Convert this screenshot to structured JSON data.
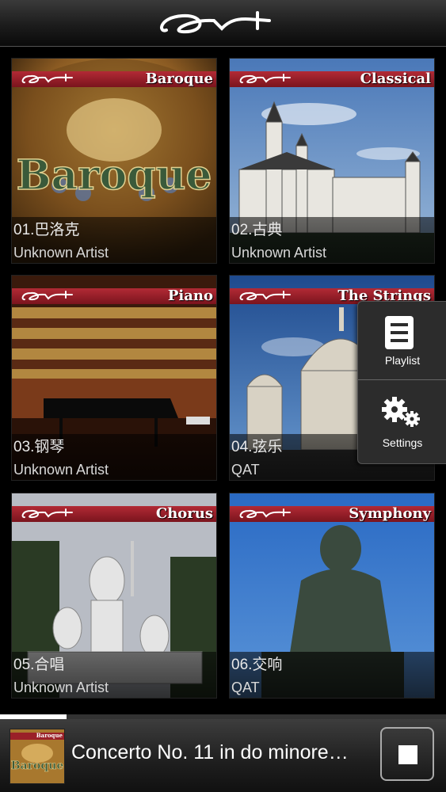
{
  "app": {
    "logo_icon": "qat-logo-icon",
    "accent": "#b22a35"
  },
  "albums": [
    {
      "genre": "Baroque",
      "title": "01.巴洛克",
      "artist": "Unknown Artist"
    },
    {
      "genre": "Classical",
      "title": "02.古典",
      "artist": "Unknown Artist"
    },
    {
      "genre": "Piano",
      "title": "03.钢琴",
      "artist": "Unknown Artist"
    },
    {
      "genre": "The Strings",
      "title": "04.弦乐",
      "artist": "QAT"
    },
    {
      "genre": "Chorus",
      "title": "05.合唱",
      "artist": "Unknown Artist"
    },
    {
      "genre": "Symphony",
      "title": "06.交响",
      "artist": "QAT"
    }
  ],
  "menu": {
    "playlist_label": "Playlist",
    "settings_label": "Settings"
  },
  "player": {
    "track_title": "Concerto No. 11 in do minore…",
    "thumb_genre": "Baroque",
    "progress": 0.15
  }
}
